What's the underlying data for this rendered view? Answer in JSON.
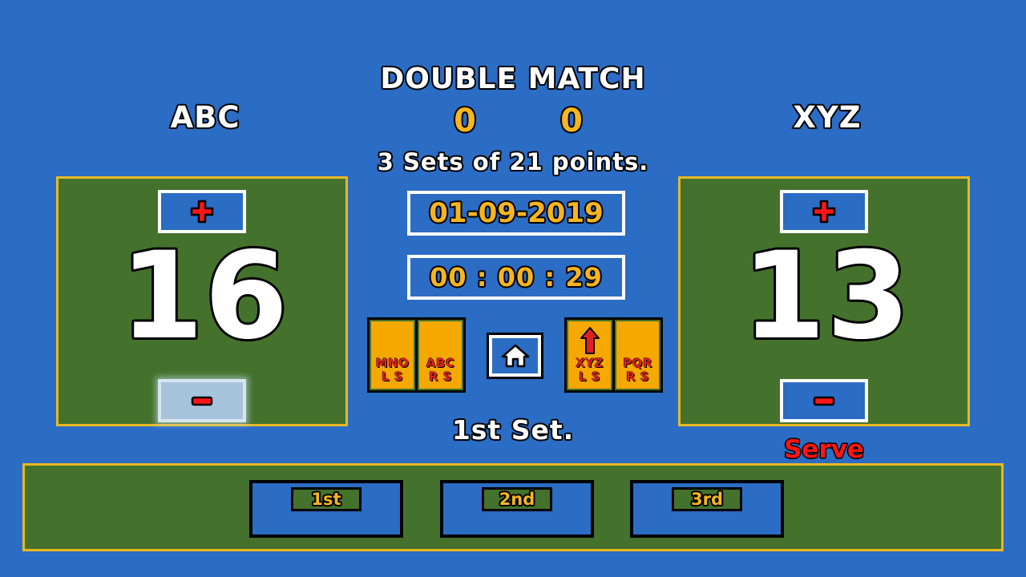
{
  "header": {
    "match_title": "DOUBLE MATCH",
    "set_score_left": "0",
    "set_score_right": "0",
    "format": "3 Sets of 21 points.",
    "date": "01-09-2019",
    "timer": "00 : 00 : 29"
  },
  "teams": {
    "left": {
      "name": "ABC",
      "score": "16",
      "plus_icon": "plus-icon",
      "minus_icon": "minus-icon",
      "minus_active": true
    },
    "right": {
      "name": "XYZ",
      "score": "13",
      "plus_icon": "plus-icon",
      "minus_icon": "minus-icon",
      "minus_active": false
    }
  },
  "players": {
    "left": [
      {
        "name": "MNO",
        "side": "L S",
        "serving": false
      },
      {
        "name": "ABC",
        "side": "R S",
        "serving": false
      }
    ],
    "right": [
      {
        "name": "XYZ",
        "side": "L S",
        "serving": true
      },
      {
        "name": "PQR",
        "side": "R S",
        "serving": false
      }
    ]
  },
  "home_button": {
    "icon": "home-icon"
  },
  "current_set": "1st Set.",
  "serve_label": "Serve",
  "set_buttons": [
    {
      "label": "1st"
    },
    {
      "label": "2nd"
    },
    {
      "label": "3rd"
    }
  ],
  "colors": {
    "background_blue": "#2B6CC4",
    "panel_green": "#44722C",
    "gold_border": "#E8B923",
    "button_orange": "#F5A800",
    "accent_red": "#E02020",
    "value_yellow": "#F5B51E",
    "active_button": "#A8C4DC"
  }
}
